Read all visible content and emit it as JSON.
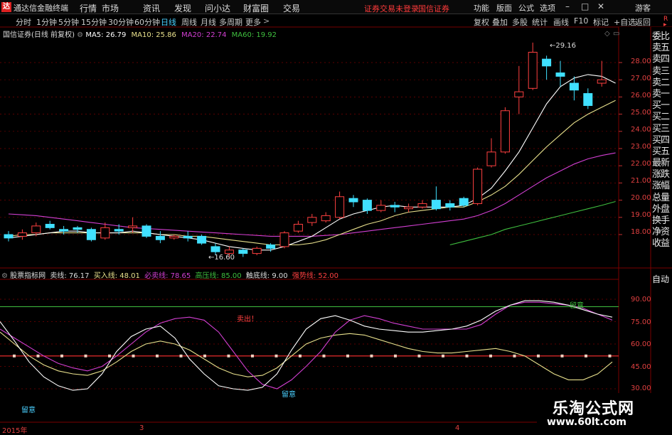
{
  "titlebar": {
    "app_name": "通达信金融终端",
    "menus": [
      "行情",
      "市场",
      "资讯",
      "发现",
      "问小达",
      "财富圈",
      "交易"
    ],
    "warn1": "证券交易未登录",
    "warn2": "国信证券",
    "right": [
      "功能",
      "版面",
      "公式",
      "选项"
    ],
    "guest": "游客"
  },
  "periods": [
    "分时",
    "1分钟",
    "5分钟",
    "15分钟",
    "30分钟",
    "60分钟",
    "日线",
    "周线",
    "月线",
    "多周期",
    "更多"
  ],
  "active_period": "日线",
  "toolbar_right": [
    "复权",
    "叠加",
    "多股",
    "统计",
    "画线",
    "F10",
    "标记",
    "+自选",
    "返回"
  ],
  "main_info": {
    "stock": "国信证券(日线 前复权)",
    "ma5": "MA5: 26.79",
    "ma10": "MA10: 25.86",
    "ma20": "MA20: 22.74",
    "ma60": "MA60: 19.92"
  },
  "colors": {
    "ma5": "#ffffff",
    "ma10": "#e8e08c",
    "ma20": "#d23fd2",
    "ma60": "#3fbf3f",
    "up": "#ff4040",
    "down": "#40e0ff",
    "grid": "#7a0000"
  },
  "price_axis": [
    "28.00",
    "27.00",
    "26.00",
    "25.00",
    "24.00",
    "23.00",
    "22.00",
    "21.00",
    "20.00",
    "19.00",
    "18.00"
  ],
  "annotations": {
    "high": "29.16",
    "low": "16.60"
  },
  "sidebar": [
    "委比",
    "卖五",
    "卖四",
    "卖三",
    "卖二",
    "卖一",
    "买一",
    "买二",
    "买三",
    "买四",
    "买五",
    "最新",
    "涨跌",
    "涨幅",
    "总量",
    "外盘",
    "换手",
    "净资",
    "收益"
  ],
  "sidebar_corner": "R",
  "indicator_info": {
    "name": "股票指标网",
    "v1": "卖线: 76.17",
    "v2": "买入线: 48.01",
    "v3": "必卖线: 78.65",
    "v4": "高压线: 85.00",
    "v5": "触底线: 9.00",
    "v6": "强势线: 52.00"
  },
  "indicator_axis": [
    "90.00",
    "75.00",
    "60.00",
    "45.00",
    "30.00"
  ],
  "indicator_labels": {
    "sell": "卖出！",
    "buy1": "留意",
    "buy2": "留意",
    "buy3": "留意"
  },
  "auto_button": "自动",
  "date_labels": [
    "2015年",
    "3",
    "4"
  ],
  "watermark": {
    "line1": "乐淘公式网",
    "line2": "www.60lt.com"
  },
  "chart_data": {
    "type": "candlestick",
    "candles": [
      {
        "o": 18.0,
        "c": 17.8,
        "h": 18.2,
        "l": 17.6
      },
      {
        "o": 17.9,
        "c": 18.1,
        "h": 18.3,
        "l": 17.7
      },
      {
        "o": 18.1,
        "c": 18.5,
        "h": 18.7,
        "l": 17.9
      },
      {
        "o": 18.6,
        "c": 18.4,
        "h": 18.8,
        "l": 18.3
      },
      {
        "o": 18.3,
        "c": 18.2,
        "h": 18.5,
        "l": 18.0
      },
      {
        "o": 18.4,
        "c": 18.3,
        "h": 18.5,
        "l": 18.1
      },
      {
        "o": 18.3,
        "c": 17.7,
        "h": 18.4,
        "l": 17.6
      },
      {
        "o": 17.8,
        "c": 18.4,
        "h": 18.7,
        "l": 17.7
      },
      {
        "o": 18.3,
        "c": 18.2,
        "h": 18.6,
        "l": 18.0
      },
      {
        "o": 18.4,
        "c": 18.5,
        "h": 19.0,
        "l": 18.1
      },
      {
        "o": 18.5,
        "c": 17.9,
        "h": 18.6,
        "l": 17.8
      },
      {
        "o": 17.9,
        "c": 17.7,
        "h": 18.2,
        "l": 17.5
      },
      {
        "o": 17.8,
        "c": 17.9,
        "h": 18.0,
        "l": 17.7
      },
      {
        "o": 17.9,
        "c": 17.8,
        "h": 18.2,
        "l": 17.6
      },
      {
        "o": 17.9,
        "c": 17.5,
        "h": 18.0,
        "l": 17.4
      },
      {
        "o": 17.3,
        "c": 17.0,
        "h": 17.5,
        "l": 16.8
      },
      {
        "o": 16.9,
        "c": 17.1,
        "h": 17.3,
        "l": 16.6
      },
      {
        "o": 17.1,
        "c": 16.9,
        "h": 17.2,
        "l": 16.7
      },
      {
        "o": 16.9,
        "c": 17.2,
        "h": 17.3,
        "l": 16.8
      },
      {
        "o": 17.4,
        "c": 17.2,
        "h": 17.5,
        "l": 17.0
      },
      {
        "o": 17.3,
        "c": 18.1,
        "h": 18.2,
        "l": 17.2
      },
      {
        "o": 18.2,
        "c": 18.6,
        "h": 18.8,
        "l": 18.1
      },
      {
        "o": 18.7,
        "c": 19.0,
        "h": 19.2,
        "l": 18.5
      },
      {
        "o": 18.8,
        "c": 19.1,
        "h": 19.3,
        "l": 18.7
      },
      {
        "o": 19.0,
        "c": 20.2,
        "h": 20.5,
        "l": 18.9
      },
      {
        "o": 20.1,
        "c": 19.9,
        "h": 20.3,
        "l": 19.6
      },
      {
        "o": 20.0,
        "c": 19.4,
        "h": 20.1,
        "l": 19.2
      },
      {
        "o": 19.4,
        "c": 19.7,
        "h": 20.0,
        "l": 19.3
      },
      {
        "o": 19.7,
        "c": 19.6,
        "h": 19.9,
        "l": 19.3
      },
      {
        "o": 19.5,
        "c": 19.6,
        "h": 19.8,
        "l": 19.3
      },
      {
        "o": 19.6,
        "c": 19.8,
        "h": 20.0,
        "l": 19.5
      },
      {
        "o": 20.0,
        "c": 19.5,
        "h": 20.8,
        "l": 19.4
      },
      {
        "o": 19.8,
        "c": 19.6,
        "h": 20.0,
        "l": 19.4
      },
      {
        "o": 20.1,
        "c": 19.7,
        "h": 20.2,
        "l": 19.6
      },
      {
        "o": 19.8,
        "c": 21.8,
        "h": 21.9,
        "l": 19.7
      },
      {
        "o": 22.0,
        "c": 22.8,
        "h": 23.6,
        "l": 21.9
      },
      {
        "o": 22.8,
        "c": 25.2,
        "h": 25.4,
        "l": 22.7
      },
      {
        "o": 26.0,
        "c": 26.3,
        "h": 27.8,
        "l": 25.0
      },
      {
        "o": 26.5,
        "c": 28.6,
        "h": 29.16,
        "l": 26.4
      },
      {
        "o": 28.2,
        "c": 27.8,
        "h": 28.4,
        "l": 27.0
      },
      {
        "o": 27.4,
        "c": 27.2,
        "h": 28.1,
        "l": 26.6
      },
      {
        "o": 26.8,
        "c": 26.4,
        "h": 27.2,
        "l": 25.8
      },
      {
        "o": 26.2,
        "c": 25.5,
        "h": 26.5,
        "l": 25.3
      },
      {
        "o": 26.8,
        "c": 27.0,
        "h": 28.1,
        "l": 26.6
      }
    ],
    "ma5": [
      17.8,
      17.9,
      18.0,
      18.1,
      18.2,
      18.2,
      18.1,
      18.1,
      18.1,
      18.2,
      18.1,
      18.0,
      17.9,
      17.8,
      17.7,
      17.5,
      17.3,
      17.2,
      17.1,
      17.1,
      17.3,
      17.6,
      17.9,
      18.4,
      18.9,
      19.2,
      19.4,
      19.6,
      19.7,
      19.6,
      19.6,
      19.6,
      19.6,
      19.7,
      20.1,
      20.7,
      21.7,
      22.8,
      24.2,
      25.6,
      26.6,
      27.1,
      27.3,
      27.2,
      26.8
    ],
    "ma10": [
      17.9,
      18.0,
      18.0,
      18.1,
      18.1,
      18.1,
      18.1,
      18.1,
      18.1,
      18.1,
      18.1,
      18.0,
      18.0,
      17.9,
      17.9,
      17.8,
      17.7,
      17.6,
      17.5,
      17.4,
      17.4,
      17.4,
      17.5,
      17.7,
      18.0,
      18.3,
      18.6,
      18.8,
      19.1,
      19.3,
      19.4,
      19.5,
      19.6,
      19.6,
      19.9,
      20.3,
      20.8,
      21.5,
      22.3,
      23.1,
      23.8,
      24.5,
      25.0,
      25.4,
      25.8
    ],
    "ma20": [
      19.2,
      19.15,
      19.1,
      19.0,
      18.9,
      18.8,
      18.7,
      18.6,
      18.5,
      18.4,
      18.35,
      18.3,
      18.25,
      18.2,
      18.15,
      18.1,
      18.05,
      18.0,
      17.95,
      17.9,
      17.9,
      17.9,
      17.9,
      17.95,
      18.0,
      18.1,
      18.2,
      18.3,
      18.4,
      18.5,
      18.6,
      18.7,
      18.8,
      18.9,
      19.1,
      19.4,
      19.8,
      20.3,
      20.8,
      21.3,
      21.7,
      22.1,
      22.4,
      22.6,
      22.75
    ],
    "ma60_start": 32,
    "ma60": [
      17.4,
      17.6,
      17.8,
      18.0,
      18.3,
      18.5,
      18.7,
      18.9,
      19.1,
      19.3,
      19.5,
      19.7,
      19.92
    ],
    "indicator": {
      "line_sell": [
        70,
        64,
        58,
        52,
        47,
        44,
        42,
        45,
        52,
        60,
        68,
        74,
        77,
        78,
        76,
        68,
        55,
        42,
        33,
        30,
        36,
        45,
        55,
        68,
        76,
        79,
        77,
        74,
        72,
        70,
        70,
        70,
        70,
        73,
        80,
        86,
        88,
        88,
        87,
        86,
        84,
        80,
        76
      ],
      "line_buy": [
        68,
        60,
        52,
        46,
        42,
        40,
        39,
        42,
        48,
        55,
        60,
        62,
        60,
        56,
        50,
        44,
        40,
        38,
        39,
        44,
        52,
        60,
        64,
        66,
        67,
        66,
        63,
        60,
        57,
        55,
        54,
        54,
        55,
        56,
        57,
        55,
        52,
        46,
        40,
        36,
        36,
        40,
        48
      ],
      "line_fast": [
        75,
        62,
        48,
        38,
        32,
        29,
        30,
        40,
        55,
        65,
        70,
        72,
        64,
        50,
        40,
        32,
        30,
        29,
        31,
        40,
        56,
        70,
        77,
        79,
        76,
        72,
        70,
        69,
        68,
        68,
        69,
        70,
        72,
        76,
        82,
        86,
        89,
        89,
        88,
        86,
        83,
        80,
        78
      ],
      "high_line": 85,
      "strong_line": 52
    }
  }
}
